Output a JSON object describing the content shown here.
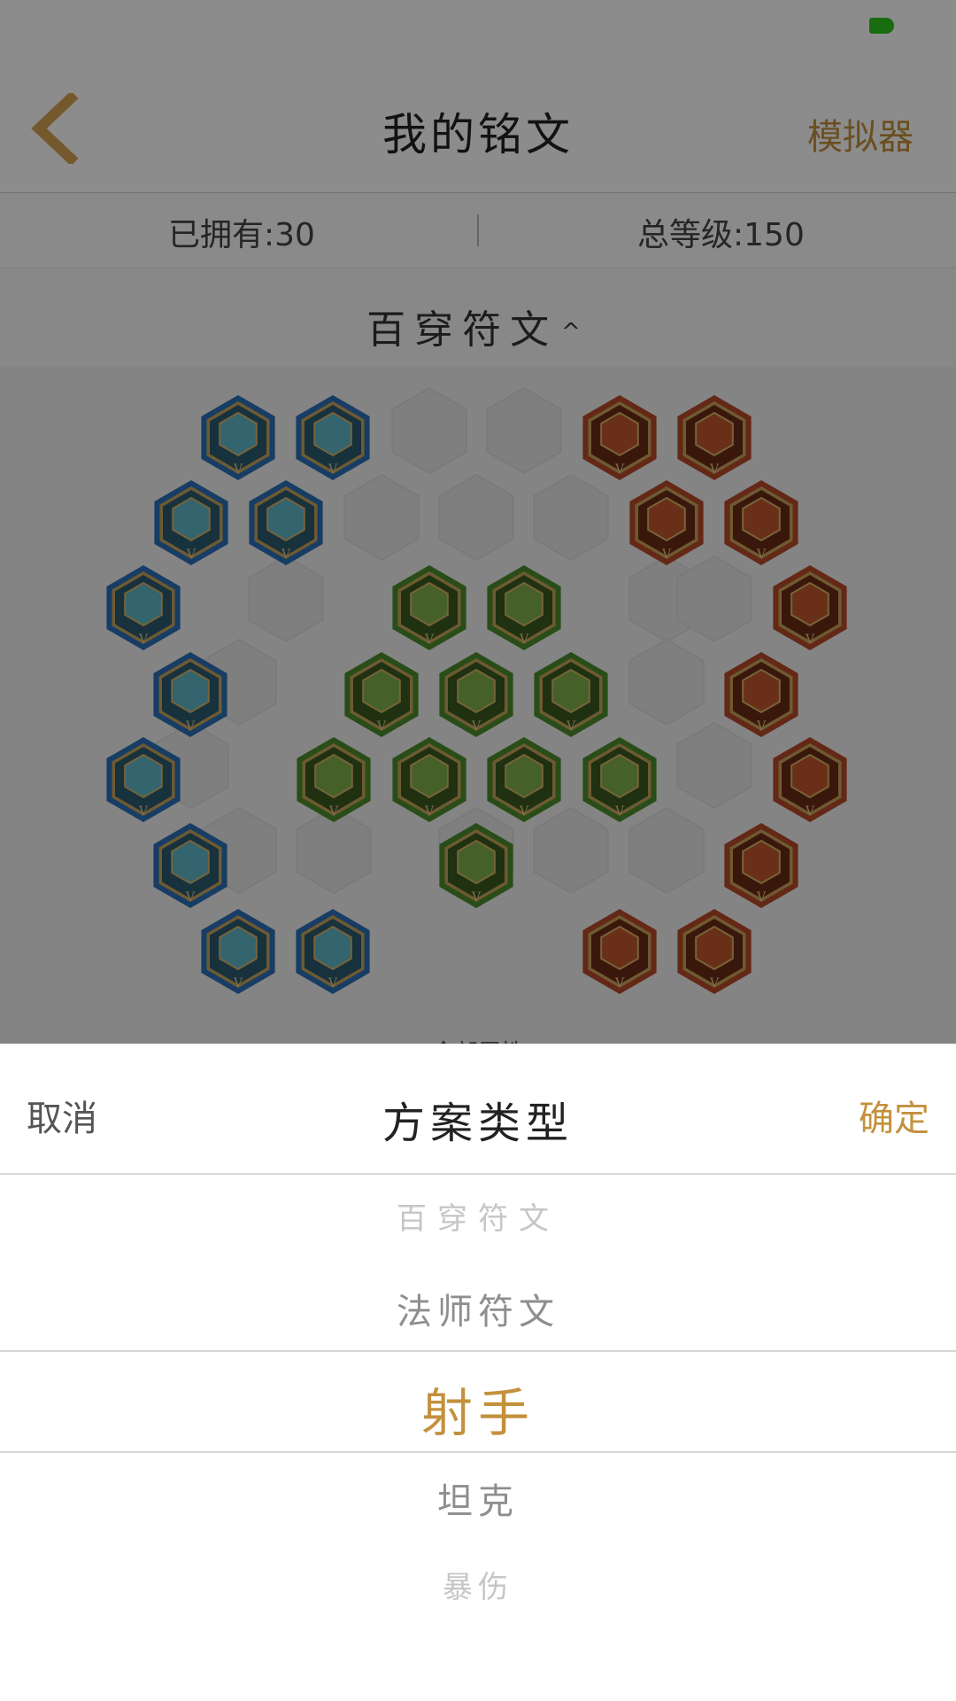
{
  "nav": {
    "title": "我的铭文",
    "action_label": "模拟器"
  },
  "stats": {
    "owned": "已拥有:30",
    "total_level": "总等级:150"
  },
  "plan": {
    "current": "百穿符文",
    "chevron": "^"
  },
  "bottom_tab": "全部属性",
  "colors": {
    "accent": "#c3913d",
    "blue_rune": "#2a6fb8",
    "green_rune": "#4c8c2c",
    "red_rune": "#b64a2a"
  },
  "rune_label": "V",
  "sheet": {
    "cancel_label": "取消",
    "title": "方案类型",
    "confirm_label": "确定",
    "options": [
      "百穿符文",
      "法师符文",
      "射手",
      "坦克",
      "暴伤"
    ],
    "selected_index": 2
  }
}
